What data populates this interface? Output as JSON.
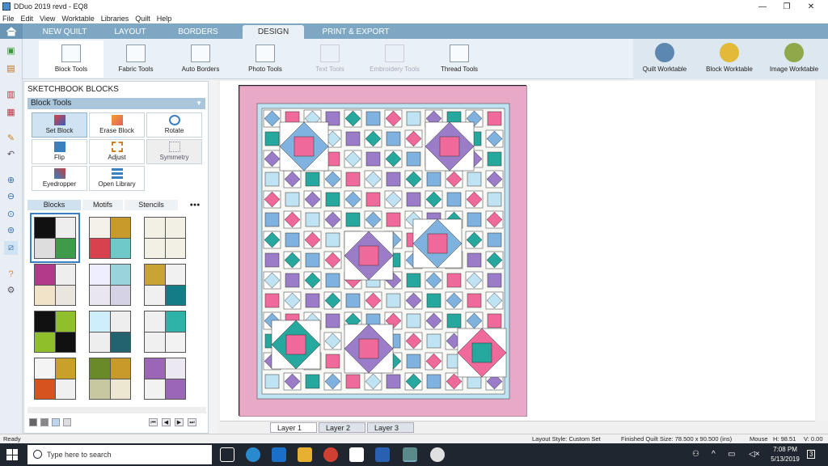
{
  "window": {
    "title": "DDuo 2019 revd - EQ8",
    "minimize": "—",
    "maximize": "❐",
    "close": "✕"
  },
  "menu": [
    "File",
    "Edit",
    "View",
    "Worktable",
    "Libraries",
    "Quilt",
    "Help"
  ],
  "tabs": [
    {
      "label": "NEW QUILT"
    },
    {
      "label": "LAYOUT"
    },
    {
      "label": "BORDERS"
    },
    {
      "label": "DESIGN",
      "active": true
    },
    {
      "label": "PRINT & EXPORT"
    }
  ],
  "ribbon": [
    {
      "label": "Block Tools",
      "state": "selected"
    },
    {
      "label": "Fabric Tools"
    },
    {
      "label": "Auto Borders"
    },
    {
      "label": "Photo Tools"
    },
    {
      "label": "Text Tools",
      "state": "disabled"
    },
    {
      "label": "Embroidery Tools",
      "state": "disabled"
    },
    {
      "label": "Thread Tools"
    }
  ],
  "worktables": [
    {
      "label": "Quilt Worktable",
      "color": "#5b87b0"
    },
    {
      "label": "Block Worktable",
      "color": "#e3b93a"
    },
    {
      "label": "Image Worktable",
      "color": "#8fa84a"
    }
  ],
  "sketchbook": {
    "title": "SKETCHBOOK BLOCKS",
    "dropdown": "Block Tools",
    "tools": [
      {
        "label": "Set Block",
        "state": "selected"
      },
      {
        "label": "Erase Block"
      },
      {
        "label": "Rotate"
      },
      {
        "label": "Flip"
      },
      {
        "label": "Adjust"
      },
      {
        "label": "Symmetry",
        "state": "disabled"
      },
      {
        "label": "Eyedropper"
      },
      {
        "label": "Open Library"
      }
    ],
    "subtabs": [
      "Blocks",
      "Motifs",
      "Stencils"
    ],
    "more": "●●●",
    "blocks": [
      [
        "#111",
        "#eee",
        "#ddd",
        "#3f9a4a"
      ],
      [
        "#f3f1ea",
        "#c69a2b",
        "#d8424e",
        "#6fc9c8"
      ],
      [
        "#f2f0e4",
        "#f2f0e4",
        "#f2f0e4",
        "#f2f0e4"
      ],
      [
        "#b33a8a",
        "#eee",
        "#f0e3c8",
        "#e8e6df"
      ],
      [
        "#eef",
        "#9ad3dc",
        "#e9e6ef",
        "#d6d2e6"
      ],
      [
        "#c9a333",
        "#f1f1f1",
        "#f0f0f0",
        "#147c86"
      ],
      [
        "#111",
        "#8fbf2a",
        "#8fbf2a",
        "#111"
      ],
      [
        "#cfeefc",
        "#eee",
        "#eee",
        "#23626f"
      ],
      [
        "#f0f0f0",
        "#2fb3a9",
        "#f0f0f0",
        "#f2f2f2"
      ],
      [
        "#f4f4f4",
        "#c9a02a",
        "#d6521f",
        "#f0f0f0"
      ],
      [
        "#6a8a2a",
        "#c89a2a",
        "#c8c8a0",
        "#ede7d2"
      ],
      [
        "#9b66b5",
        "#ece8f2",
        "#f2f2f2",
        "#9b66b5"
      ]
    ],
    "nav": [
      "⏮",
      "◀",
      "▶",
      "⏭"
    ]
  },
  "layers": [
    {
      "label": "Layer 1",
      "active": true
    },
    {
      "label": "Layer 2"
    },
    {
      "label": "Layer 3"
    }
  ],
  "status": {
    "left": "Ready",
    "layout": "Layout Style: Custom Set",
    "size": "Finished Quilt Size: 78.500 x 90.500 (ins)",
    "mouse": "Mouse",
    "h": "H:  98.51",
    "v": "V:  0.00"
  },
  "quilt_colors": {
    "border": "#e8a9c6",
    "sash": "#f7f7f4",
    "star_blue": "#7fb2de",
    "star_purple": "#9b7cc8",
    "pink": "#ef6a9a",
    "teal": "#27a89e",
    "lightblue": "#bfe3f2"
  },
  "taskbar": {
    "search": "Type here to search",
    "time": "7:08 PM",
    "date": "5/13/2019",
    "notif": "3"
  }
}
